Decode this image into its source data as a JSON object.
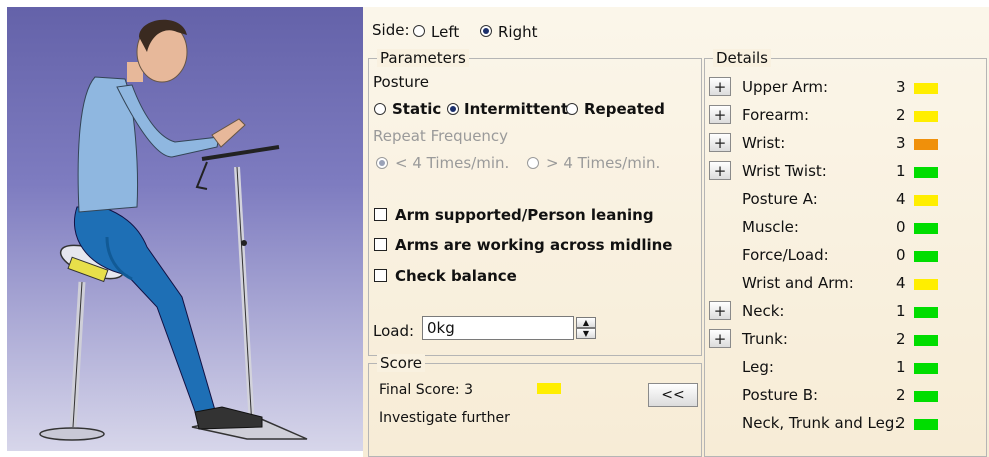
{
  "side": {
    "label": "Side:",
    "options": [
      "Left",
      "Right"
    ],
    "selected": "Right"
  },
  "parameters": {
    "title": "Parameters",
    "posture_label": "Posture",
    "posture_options": [
      "Static",
      "Intermittent",
      "Repeated"
    ],
    "posture_selected": "Intermittent",
    "repeat_frequency_label": "Repeat Frequency",
    "repeat_options": [
      "< 4 Times/min.",
      "> 4 Times/min."
    ],
    "repeat_selected": "< 4 Times/min.",
    "checkboxes": [
      "Arm supported/Person leaning",
      "Arms are working across midline",
      "Check balance"
    ],
    "load_label": "Load:",
    "load_value": "0kg"
  },
  "score": {
    "title": "Score",
    "final_score_text": "Final Score: 3",
    "final_score_color": "#ffee00",
    "message": "Investigate further",
    "collapse_button": "<<"
  },
  "details": {
    "title": "Details",
    "rows": [
      {
        "label": "Upper Arm:",
        "value": "3",
        "color": "#ffee00",
        "expandable": true
      },
      {
        "label": "Forearm:",
        "value": "2",
        "color": "#ffee00",
        "expandable": true
      },
      {
        "label": "Wrist:",
        "value": "3",
        "color": "#f0900a",
        "expandable": true
      },
      {
        "label": "Wrist Twist:",
        "value": "1",
        "color": "#00dd00",
        "expandable": true
      },
      {
        "label": "Posture A:",
        "value": "4",
        "color": "#ffee00",
        "expandable": false
      },
      {
        "label": "Muscle:",
        "value": "0",
        "color": "#00dd00",
        "expandable": false
      },
      {
        "label": "Force/Load:",
        "value": "0",
        "color": "#00dd00",
        "expandable": false
      },
      {
        "label": "Wrist and Arm:",
        "value": "4",
        "color": "#ffee00",
        "expandable": false
      },
      {
        "label": "Neck:",
        "value": "1",
        "color": "#00dd00",
        "expandable": true
      },
      {
        "label": "Trunk:",
        "value": "2",
        "color": "#00dd00",
        "expandable": true
      },
      {
        "label": "Leg:",
        "value": "1",
        "color": "#00dd00",
        "expandable": false
      },
      {
        "label": "Posture B:",
        "value": "2",
        "color": "#00dd00",
        "expandable": false
      },
      {
        "label": "Neck, Trunk and Leg:",
        "value": "2",
        "color": "#00dd00",
        "expandable": false
      }
    ]
  },
  "plus_label": "+"
}
